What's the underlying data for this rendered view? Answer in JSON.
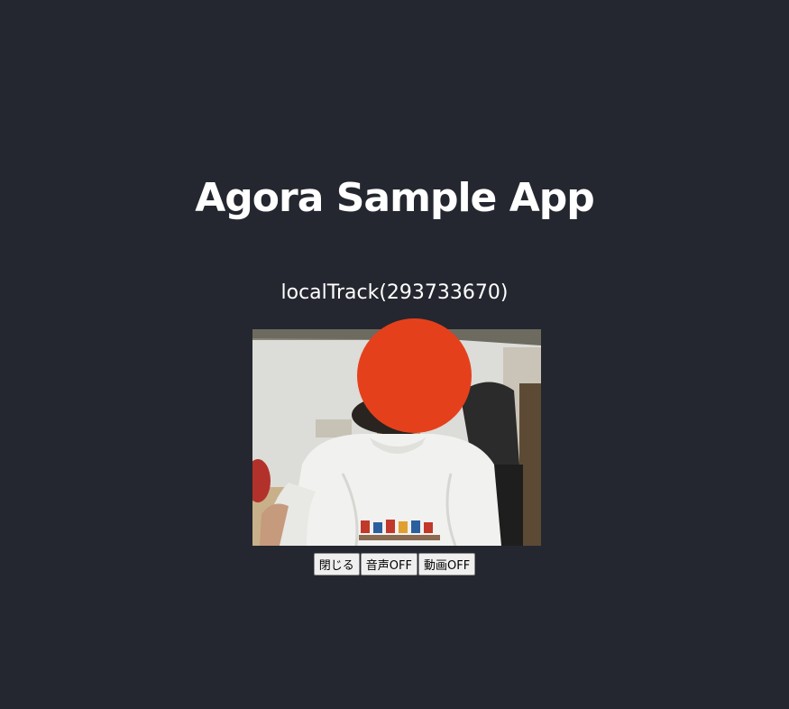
{
  "app": {
    "title": "Agora Sample App"
  },
  "local_track": {
    "label": "localTrack(293733670)"
  },
  "controls": {
    "close_label": "閉じる",
    "audio_off_label": "音声OFF",
    "video_off_label": "動画OFF"
  },
  "colors": {
    "background": "#24272f",
    "text": "#ffffff",
    "face_mask": "#e5401c",
    "button_background": "#efefef"
  }
}
